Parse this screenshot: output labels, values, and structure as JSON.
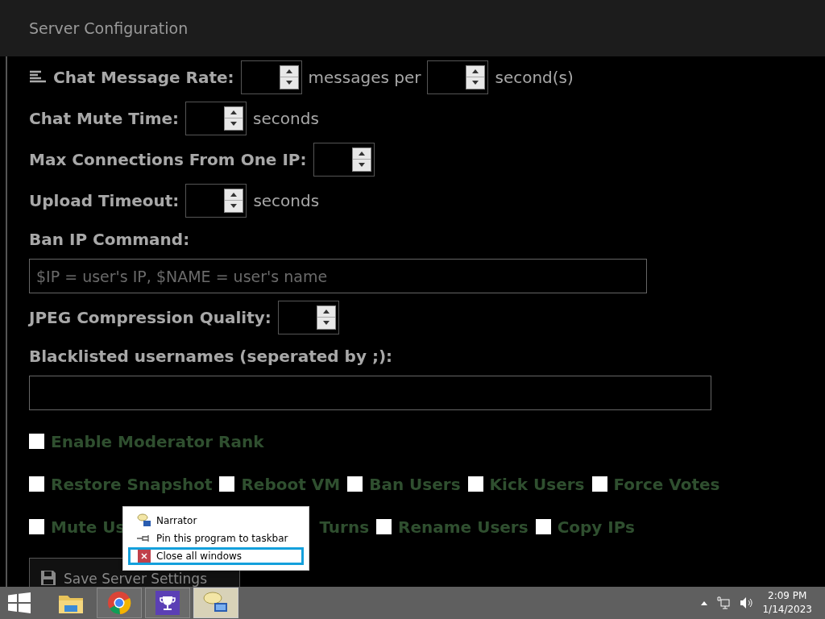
{
  "header": {
    "title": "Server Configuration"
  },
  "fields": [
    {
      "kind": "icon_spin_row",
      "label": "Chat Message Rate:",
      "parts": [
        {
          "kind": "spin"
        },
        {
          "kind": "unit",
          "text": "messages per"
        },
        {
          "kind": "spin"
        },
        {
          "kind": "unit",
          "text": "second(s)"
        }
      ]
    },
    {
      "kind": "spin_row",
      "label": "Chat Mute Time:",
      "parts": [
        {
          "kind": "spin"
        },
        {
          "kind": "unit",
          "text": "seconds"
        }
      ]
    },
    {
      "kind": "spin_row",
      "label": "Max Connections From One IP:",
      "parts": [
        {
          "kind": "spin"
        }
      ]
    },
    {
      "kind": "spin_row",
      "label": "Upload Timeout:",
      "parts": [
        {
          "kind": "spin"
        },
        {
          "kind": "unit",
          "text": "seconds"
        }
      ]
    },
    {
      "kind": "text_field",
      "label": "Ban IP Command:",
      "placeholder": "$IP = user's IP, $NAME = user's name"
    },
    {
      "kind": "spin_row",
      "label": "JPEG Compression Quality:",
      "parts": [
        {
          "kind": "spin"
        }
      ]
    },
    {
      "kind": "wide_text_field",
      "label": "Blacklisted usernames (seperated by ;):"
    }
  ],
  "checkbox_rows": [
    [
      {
        "kind": "checkbox",
        "label": "Enable Moderator Rank",
        "checked": false
      }
    ],
    [
      {
        "kind": "checkbox",
        "label": "Restore Snapshot",
        "checked": false
      },
      {
        "kind": "checkbox",
        "label": "Reboot VM",
        "checked": false
      },
      {
        "kind": "checkbox",
        "label": "Ban Users",
        "checked": false
      },
      {
        "kind": "checkbox",
        "label": "Kick Users",
        "checked": false
      },
      {
        "kind": "checkbox",
        "label": "Force Votes",
        "checked": false
      }
    ],
    [
      {
        "kind": "checkbox",
        "label": "Mute Us",
        "checked": false
      },
      {
        "kind": "fragment",
        "label": "Turns"
      },
      {
        "kind": "checkbox",
        "label": "Rename Users",
        "checked": false
      },
      {
        "kind": "checkbox",
        "label": "Copy IPs",
        "checked": false
      }
    ]
  ],
  "save_button": {
    "label": "Save Server Settings"
  },
  "context_menu": {
    "items": [
      {
        "kind": "narrator",
        "label": "Narrator",
        "selected": false
      },
      {
        "kind": "pin",
        "label": "Pin this program to taskbar",
        "selected": false
      },
      {
        "kind": "close",
        "label": "Close all windows",
        "selected": true
      }
    ]
  },
  "taskbar": {
    "apps": [
      {
        "kind": "explorer",
        "active": false
      },
      {
        "kind": "chrome",
        "active": false
      },
      {
        "kind": "trophy",
        "active": false
      },
      {
        "kind": "narrator",
        "active": true
      }
    ],
    "time": "2:09 PM",
    "date": "1/14/2023"
  }
}
